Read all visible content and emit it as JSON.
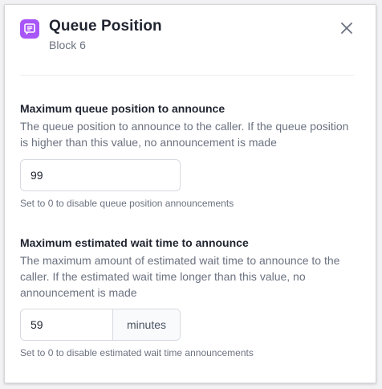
{
  "header": {
    "title": "Queue Position",
    "subtitle": "Block 6",
    "icon": "message-block-icon",
    "accent_color": "#a855f7"
  },
  "fields": {
    "max_position": {
      "label": "Maximum queue position to announce",
      "description": "The queue position to announce to the caller. If the queue position is higher than this value, no announcement is made",
      "value": "99",
      "hint": "Set to 0 to disable queue position announcements"
    },
    "max_wait": {
      "label": "Maximum estimated wait time to announce",
      "description": "The maximum amount of estimated wait time to announce to the caller. If the estimated wait time longer than this value, no announcement is made",
      "value": "59",
      "unit": "minutes",
      "hint": "Set to 0 to disable estimated wait time announcements"
    }
  }
}
